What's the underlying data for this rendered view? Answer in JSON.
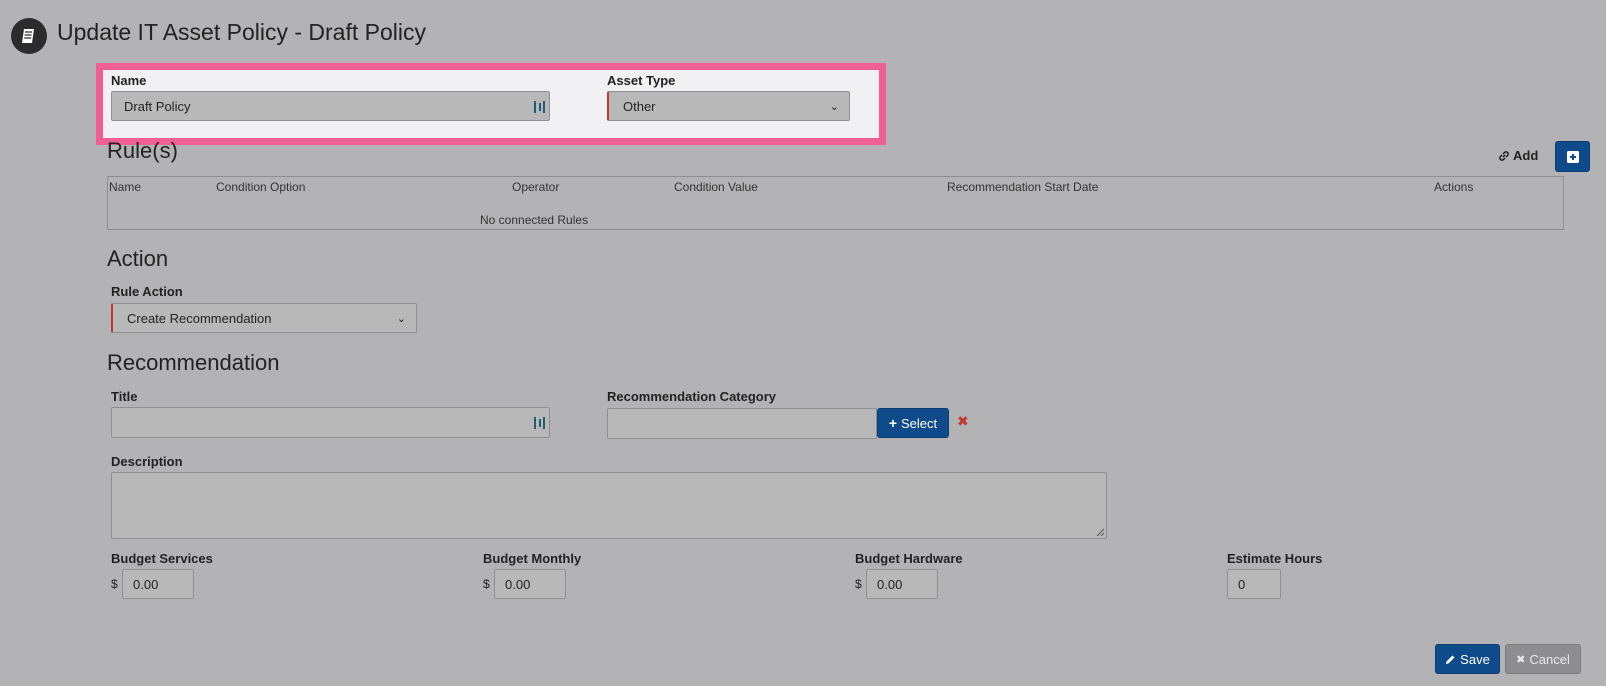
{
  "header": {
    "title": "Update IT Asset Policy - Draft Policy",
    "icon": "book-icon"
  },
  "form": {
    "name_label": "Name",
    "name_value": "Draft Policy",
    "asset_type_label": "Asset Type",
    "asset_type_value": "Other"
  },
  "rules": {
    "heading": "Rule(s)",
    "add_label": "Add",
    "columns": [
      "Name",
      "Condition Option",
      "Operator",
      "Condition Value",
      "Recommendation Start Date",
      "Actions"
    ],
    "empty_text": "No connected Rules"
  },
  "action": {
    "heading": "Action",
    "rule_action_label": "Rule Action",
    "rule_action_value": "Create Recommendation"
  },
  "recommendation": {
    "heading": "Recommendation",
    "title_label": "Title",
    "title_value": "",
    "category_label": "Recommendation Category",
    "category_value": "",
    "select_label": "Select",
    "description_label": "Description",
    "description_value": ""
  },
  "budget": {
    "services_label": "Budget Services",
    "services_value": "0.00",
    "monthly_label": "Budget Monthly",
    "monthly_value": "0.00",
    "hardware_label": "Budget Hardware",
    "hardware_value": "0.00",
    "hours_label": "Estimate Hours",
    "hours_value": "0",
    "currency": "$"
  },
  "footer": {
    "save_label": "Save",
    "cancel_label": "Cancel"
  },
  "colors": {
    "background": "#b3b3b5",
    "primary": "#0f4a8a",
    "highlight": "#ef5f93",
    "danger": "#c0392b"
  }
}
